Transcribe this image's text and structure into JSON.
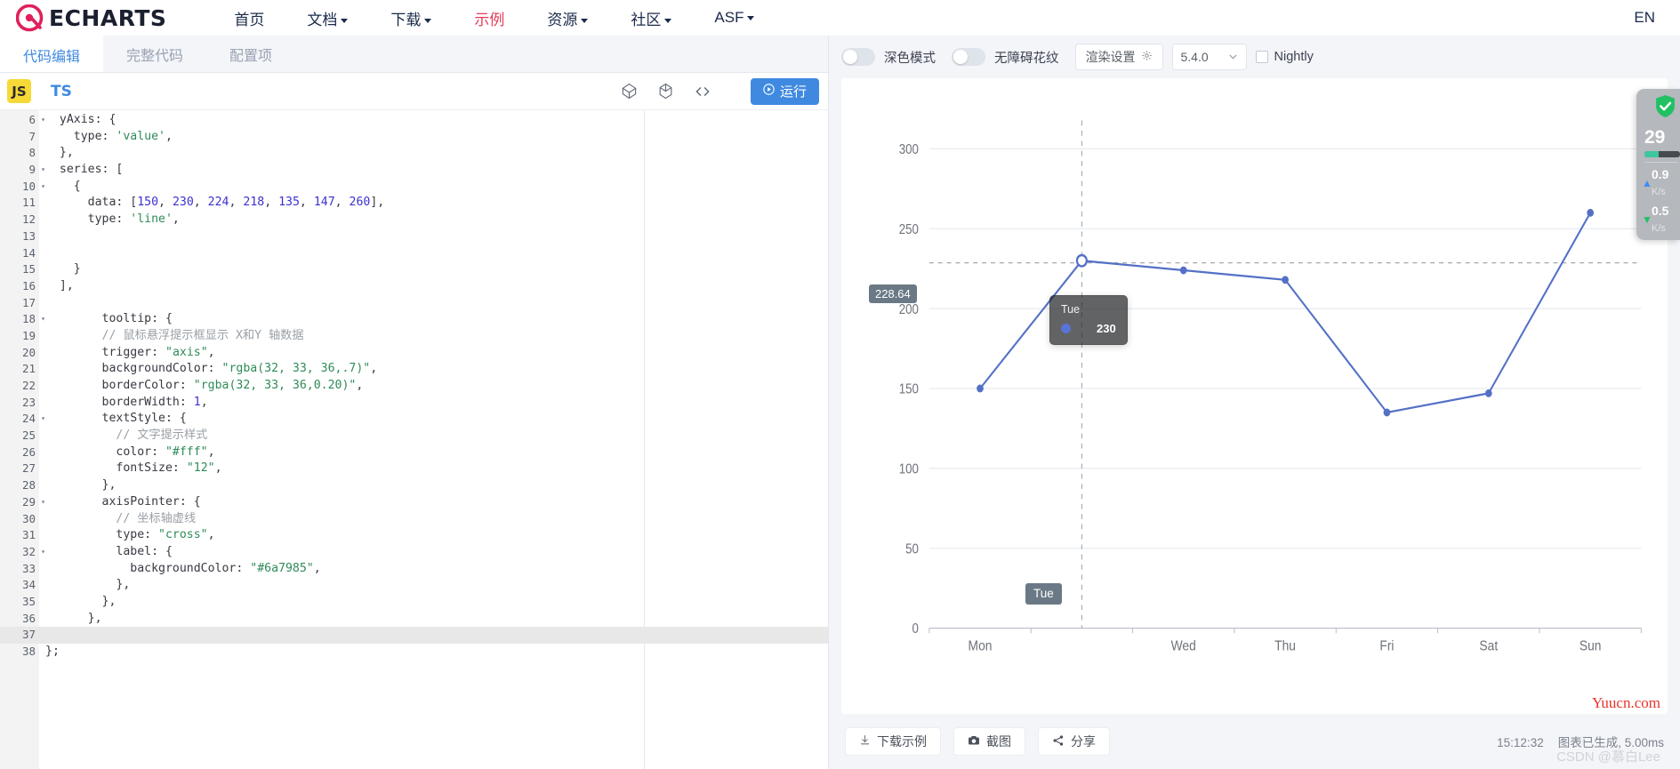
{
  "site": {
    "brand": "ECHARTS",
    "nav": [
      {
        "label": "首页",
        "has_caret": false,
        "active": false
      },
      {
        "label": "文档",
        "has_caret": true,
        "active": false
      },
      {
        "label": "下载",
        "has_caret": true,
        "active": false
      },
      {
        "label": "示例",
        "has_caret": false,
        "active": true
      },
      {
        "label": "资源",
        "has_caret": true,
        "active": false
      },
      {
        "label": "社区",
        "has_caret": true,
        "active": false
      },
      {
        "label": "ASF",
        "has_caret": true,
        "active": false
      }
    ],
    "lang_switch": "EN"
  },
  "editor": {
    "tabs": [
      {
        "label": "代码编辑",
        "active": true
      },
      {
        "label": "完整代码",
        "active": false
      },
      {
        "label": "配置项",
        "active": false
      }
    ],
    "lang_js": "JS",
    "lang_ts": "TS",
    "run_label": "运行",
    "icons": [
      "cube-outline-icon",
      "box-icon",
      "code-brackets-icon"
    ],
    "first_line_number": 6,
    "highlight_line": 37,
    "lines": [
      {
        "n": 6,
        "fold": true,
        "indent": 1,
        "tokens": [
          {
            "t": "key",
            "v": "yAxis: {"
          }
        ]
      },
      {
        "n": 7,
        "fold": false,
        "indent": 2,
        "tokens": [
          {
            "t": "key",
            "v": "type: "
          },
          {
            "t": "str",
            "v": "'value'"
          },
          {
            "t": "pun",
            "v": ","
          }
        ]
      },
      {
        "n": 8,
        "fold": false,
        "indent": 1,
        "tokens": [
          {
            "t": "pun",
            "v": "},"
          }
        ]
      },
      {
        "n": 9,
        "fold": true,
        "indent": 1,
        "tokens": [
          {
            "t": "key",
            "v": "series: ["
          }
        ]
      },
      {
        "n": 10,
        "fold": true,
        "indent": 2,
        "tokens": [
          {
            "t": "pun",
            "v": "{"
          }
        ]
      },
      {
        "n": 11,
        "fold": false,
        "indent": 3,
        "tokens": [
          {
            "t": "key",
            "v": "data: ["
          },
          {
            "t": "num",
            "v": "150"
          },
          {
            "t": "pun",
            "v": ", "
          },
          {
            "t": "num",
            "v": "230"
          },
          {
            "t": "pun",
            "v": ", "
          },
          {
            "t": "num",
            "v": "224"
          },
          {
            "t": "pun",
            "v": ", "
          },
          {
            "t": "num",
            "v": "218"
          },
          {
            "t": "pun",
            "v": ", "
          },
          {
            "t": "num",
            "v": "135"
          },
          {
            "t": "pun",
            "v": ", "
          },
          {
            "t": "num",
            "v": "147"
          },
          {
            "t": "pun",
            "v": ", "
          },
          {
            "t": "num",
            "v": "260"
          },
          {
            "t": "pun",
            "v": "],"
          }
        ]
      },
      {
        "n": 12,
        "fold": false,
        "indent": 3,
        "tokens": [
          {
            "t": "key",
            "v": "type: "
          },
          {
            "t": "str",
            "v": "'line'"
          },
          {
            "t": "pun",
            "v": ","
          }
        ]
      },
      {
        "n": 13,
        "fold": false,
        "indent": 0,
        "tokens": []
      },
      {
        "n": 14,
        "fold": false,
        "indent": 0,
        "tokens": []
      },
      {
        "n": 15,
        "fold": false,
        "indent": 2,
        "tokens": [
          {
            "t": "pun",
            "v": "}"
          }
        ]
      },
      {
        "n": 16,
        "fold": false,
        "indent": 1,
        "tokens": [
          {
            "t": "pun",
            "v": "],"
          }
        ]
      },
      {
        "n": 17,
        "fold": false,
        "indent": 0,
        "tokens": []
      },
      {
        "n": 18,
        "fold": true,
        "indent": 4,
        "tokens": [
          {
            "t": "key",
            "v": "tooltip: {"
          }
        ]
      },
      {
        "n": 19,
        "fold": false,
        "indent": 4,
        "tokens": [
          {
            "t": "com",
            "v": "// 鼠标悬浮提示框显示 X和Y 轴数据"
          }
        ]
      },
      {
        "n": 20,
        "fold": false,
        "indent": 4,
        "tokens": [
          {
            "t": "key",
            "v": "trigger: "
          },
          {
            "t": "str",
            "v": "\"axis\""
          },
          {
            "t": "pun",
            "v": ","
          }
        ]
      },
      {
        "n": 21,
        "fold": false,
        "indent": 4,
        "tokens": [
          {
            "t": "key",
            "v": "backgroundColor: "
          },
          {
            "t": "str",
            "v": "\"rgba(32, 33, 36,.7)\""
          },
          {
            "t": "pun",
            "v": ","
          }
        ]
      },
      {
        "n": 22,
        "fold": false,
        "indent": 4,
        "tokens": [
          {
            "t": "key",
            "v": "borderColor: "
          },
          {
            "t": "str",
            "v": "\"rgba(32, 33, 36,0.20)\""
          },
          {
            "t": "pun",
            "v": ","
          }
        ]
      },
      {
        "n": 23,
        "fold": false,
        "indent": 4,
        "tokens": [
          {
            "t": "key",
            "v": "borderWidth: "
          },
          {
            "t": "num",
            "v": "1"
          },
          {
            "t": "pun",
            "v": ","
          }
        ]
      },
      {
        "n": 24,
        "fold": true,
        "indent": 4,
        "tokens": [
          {
            "t": "key",
            "v": "textStyle: {"
          }
        ]
      },
      {
        "n": 25,
        "fold": false,
        "indent": 5,
        "tokens": [
          {
            "t": "com",
            "v": "// 文字提示样式"
          }
        ]
      },
      {
        "n": 26,
        "fold": false,
        "indent": 5,
        "tokens": [
          {
            "t": "key",
            "v": "color: "
          },
          {
            "t": "str",
            "v": "\"#fff\""
          },
          {
            "t": "pun",
            "v": ","
          }
        ]
      },
      {
        "n": 27,
        "fold": false,
        "indent": 5,
        "tokens": [
          {
            "t": "key",
            "v": "fontSize: "
          },
          {
            "t": "str",
            "v": "\"12\""
          },
          {
            "t": "pun",
            "v": ","
          }
        ]
      },
      {
        "n": 28,
        "fold": false,
        "indent": 4,
        "tokens": [
          {
            "t": "pun",
            "v": "},"
          }
        ]
      },
      {
        "n": 29,
        "fold": true,
        "indent": 4,
        "tokens": [
          {
            "t": "key",
            "v": "axisPointer: {"
          }
        ]
      },
      {
        "n": 30,
        "fold": false,
        "indent": 5,
        "tokens": [
          {
            "t": "com",
            "v": "// 坐标轴虚线"
          }
        ]
      },
      {
        "n": 31,
        "fold": false,
        "indent": 5,
        "tokens": [
          {
            "t": "key",
            "v": "type: "
          },
          {
            "t": "str",
            "v": "\"cross\""
          },
          {
            "t": "pun",
            "v": ","
          }
        ]
      },
      {
        "n": 32,
        "fold": true,
        "indent": 5,
        "tokens": [
          {
            "t": "key",
            "v": "label: {"
          }
        ]
      },
      {
        "n": 33,
        "fold": false,
        "indent": 6,
        "tokens": [
          {
            "t": "key",
            "v": "backgroundColor: "
          },
          {
            "t": "str",
            "v": "\"#6a7985\""
          },
          {
            "t": "pun",
            "v": ","
          }
        ]
      },
      {
        "n": 34,
        "fold": false,
        "indent": 5,
        "tokens": [
          {
            "t": "pun",
            "v": "},"
          }
        ]
      },
      {
        "n": 35,
        "fold": false,
        "indent": 4,
        "tokens": [
          {
            "t": "pun",
            "v": "},"
          }
        ]
      },
      {
        "n": 36,
        "fold": false,
        "indent": 3,
        "tokens": [
          {
            "t": "pun",
            "v": "},"
          }
        ]
      },
      {
        "n": 37,
        "fold": false,
        "indent": 0,
        "tokens": []
      },
      {
        "n": 38,
        "fold": false,
        "indent": 0,
        "tokens": [
          {
            "t": "pun",
            "v": "};"
          }
        ]
      }
    ]
  },
  "preview": {
    "dark_mode_label": "深色模式",
    "dark_mode_on": false,
    "accessible_pattern_label": "无障碍花纹",
    "accessible_pattern_on": false,
    "render_settings_label": "渲染设置",
    "version": "5.4.0",
    "nightly_label": "Nightly",
    "nightly_checked": false,
    "footer": {
      "download_label": "下载示例",
      "screenshot_label": "截图",
      "share_label": "分享",
      "time": "15:12:32",
      "status": "图表已生成, 5.00ms",
      "watermark_red": "Yuucn.com",
      "watermark_gray": "CSDN @慕白Lee"
    }
  },
  "chart_data": {
    "type": "line",
    "title": "",
    "xlabel": "",
    "ylabel": "",
    "categories": [
      "Mon",
      "Tue",
      "Wed",
      "Thu",
      "Fri",
      "Sat",
      "Sun"
    ],
    "series": [
      {
        "name": "",
        "values": [
          150,
          230,
          224,
          218,
          135,
          147,
          260
        ],
        "color": "#5470c6"
      }
    ],
    "y_ticks": [
      0,
      50,
      100,
      150,
      200,
      250,
      300
    ],
    "ylim": [
      0,
      300
    ],
    "grid": true,
    "legend": "none",
    "axis_pointer": {
      "type": "cross",
      "active_category": "Tue",
      "y_label_value": "228.64",
      "label_background": "#6a7985"
    },
    "tooltip": {
      "title": "Tue",
      "value": "230",
      "marker_color": "#5470c6",
      "background": "rgba(32, 33, 36, .7)"
    }
  },
  "speed_widget": {
    "big_number": "29",
    "up_value": "0.9",
    "up_unit": "K/s",
    "down_value": "0.5",
    "down_unit": "K/s"
  }
}
